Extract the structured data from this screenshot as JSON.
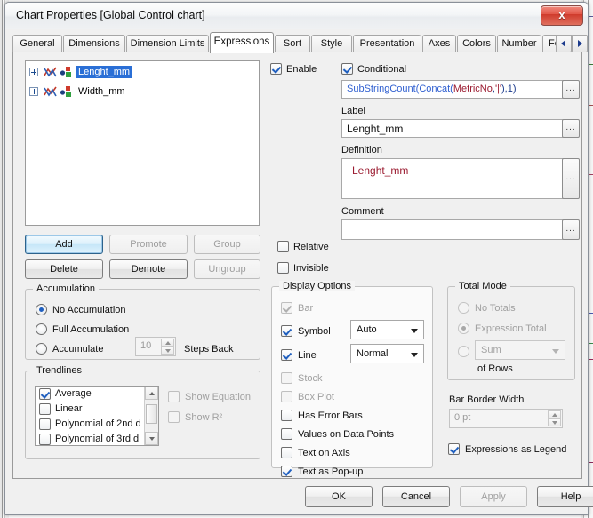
{
  "window": {
    "title": "Chart Properties [Global Control chart]",
    "close_label": "x"
  },
  "tabs": {
    "items": [
      {
        "label": "General",
        "active": false
      },
      {
        "label": "Dimensions",
        "active": false
      },
      {
        "label": "Dimension Limits",
        "active": false
      },
      {
        "label": "Expressions",
        "active": true
      },
      {
        "label": "Sort",
        "active": false
      },
      {
        "label": "Style",
        "active": false
      },
      {
        "label": "Presentation",
        "active": false
      },
      {
        "label": "Axes",
        "active": false
      },
      {
        "label": "Colors",
        "active": false
      },
      {
        "label": "Number",
        "active": false
      },
      {
        "label": "Font",
        "active": false
      }
    ],
    "nav_prev": "◄",
    "nav_next": "►"
  },
  "expression_tree": {
    "items": [
      {
        "label": "Lenght_mm",
        "selected": true
      },
      {
        "label": "Width_mm",
        "selected": false
      }
    ]
  },
  "list_buttons": {
    "add": "Add",
    "promote": "Promote",
    "group": "Group",
    "delete": "Delete",
    "demote": "Demote",
    "ungroup": "Ungroup"
  },
  "accumulation": {
    "title": "Accumulation",
    "no_accumulation": "No Accumulation",
    "full_accumulation": "Full Accumulation",
    "accumulate": "Accumulate",
    "steps_value": "10",
    "steps_back": "Steps Back",
    "selected": "no_accumulation"
  },
  "trendlines": {
    "title": "Trendlines",
    "items": [
      {
        "label": "Average",
        "checked": true
      },
      {
        "label": "Linear",
        "checked": false
      },
      {
        "label": "Polynomial of 2nd d",
        "checked": false
      },
      {
        "label": "Polynomial of 3rd d",
        "checked": false
      }
    ],
    "show_equation": "Show Equation",
    "show_r2": "Show R²"
  },
  "expression_settings": {
    "enable": "Enable",
    "conditional": "Conditional",
    "conditional_expression": {
      "full": "SubStringCount(Concat(MetricNo,'|'),1)",
      "tokens": [
        {
          "text": "SubStringCount(",
          "kind": "fn"
        },
        {
          "text": "Concat(",
          "kind": "fn"
        },
        {
          "text": "MetricNo",
          "kind": "fld"
        },
        {
          "text": ",",
          "kind": "par"
        },
        {
          "text": "'|'",
          "kind": "str"
        },
        {
          "text": ")",
          "kind": "par"
        },
        {
          "text": ",",
          "kind": "par"
        },
        {
          "text": "1",
          "kind": "num"
        },
        {
          "text": ")",
          "kind": "par"
        }
      ]
    },
    "label_caption": "Label",
    "label_value": "Lenght_mm",
    "definition_caption": "Definition",
    "definition_value": "Lenght_mm",
    "comment_caption": "Comment",
    "comment_value": "",
    "ellipsis": "...",
    "relative": "Relative",
    "invisible": "Invisible"
  },
  "display_options": {
    "title": "Display Options",
    "bar": "Bar",
    "symbol": "Symbol",
    "symbol_value": "Auto",
    "line": "Line",
    "line_value": "Normal",
    "stock": "Stock",
    "box_plot": "Box Plot",
    "has_error_bars": "Has Error Bars",
    "values_on_data_points": "Values on Data Points",
    "text_on_axis": "Text on Axis",
    "text_as_popup": "Text as Pop-up"
  },
  "total_mode": {
    "title": "Total Mode",
    "no_totals": "No Totals",
    "expression_total": "Expression Total",
    "aggregation_value": "Sum",
    "of_rows": "of Rows",
    "selected": "expression_total"
  },
  "bar_border_width": {
    "caption": "Bar Border Width",
    "value": "0 pt"
  },
  "expressions_as_legend": {
    "label": "Expressions as Legend",
    "checked": true
  },
  "footer": {
    "ok": "OK",
    "cancel": "Cancel",
    "apply": "Apply",
    "help": "Help"
  },
  "colors": {
    "selection_blue": "#2a6fd6",
    "function_blue": "#2f5fd0",
    "field_red": "#9b1b30",
    "close_red": "#cf3b2c",
    "dialog_bg": "#f0f0f0"
  }
}
